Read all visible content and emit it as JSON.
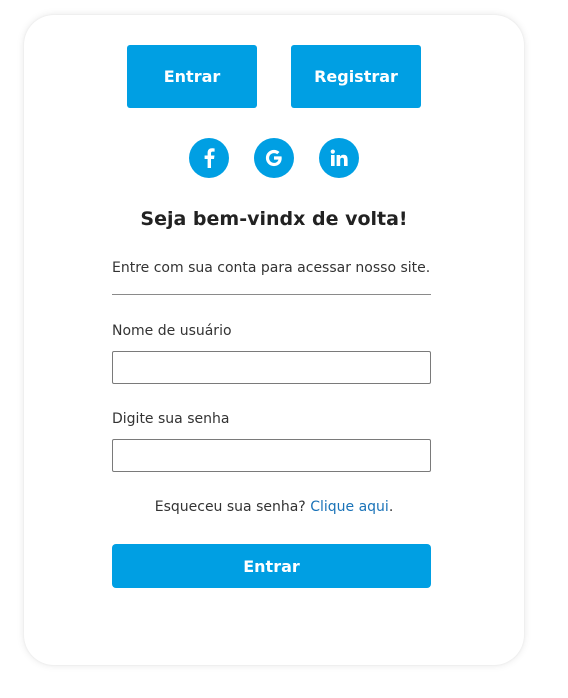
{
  "tabs": {
    "login_label": "Entrar",
    "register_label": "Registrar"
  },
  "social": {
    "icons": [
      "facebook-icon",
      "google-icon",
      "linkedin-icon"
    ]
  },
  "header": {
    "title": "Seja bem-vindx de volta!",
    "subtitle": "Entre com sua conta para acessar nosso site."
  },
  "form": {
    "username_label": "Nome de usuário",
    "username_value": "",
    "password_label": "Digite sua senha",
    "password_value": "",
    "forgot_text": "Esqueceu sua senha?",
    "forgot_link": "Clique aqui",
    "forgot_suffix": ".",
    "submit_label": "Entrar"
  },
  "colors": {
    "accent": "#009fe3",
    "link": "#1a73b8",
    "text": "#333333"
  }
}
